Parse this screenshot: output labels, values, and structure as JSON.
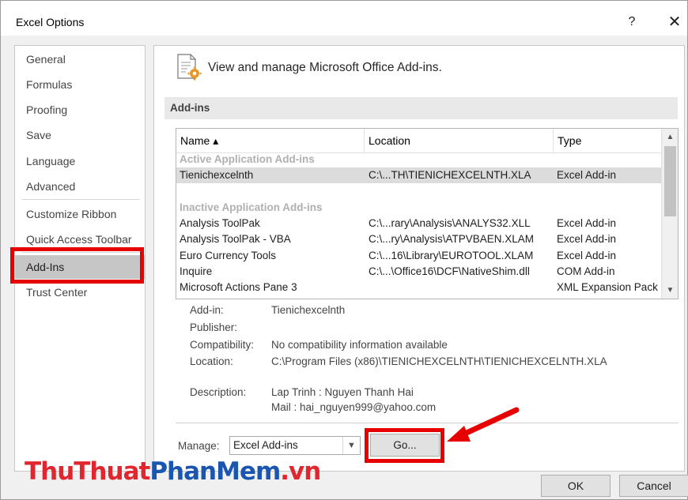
{
  "window": {
    "title": "Excel Options",
    "help_label": "?",
    "close_label": "✕"
  },
  "sidebar": {
    "items": [
      {
        "label": "General"
      },
      {
        "label": "Formulas"
      },
      {
        "label": "Proofing"
      },
      {
        "label": "Save"
      },
      {
        "label": "Language"
      },
      {
        "label": "Advanced"
      },
      {
        "label": "Customize Ribbon"
      },
      {
        "label": "Quick Access Toolbar"
      },
      {
        "label": "Add-Ins"
      },
      {
        "label": "Trust Center"
      }
    ],
    "selected": "Add-Ins"
  },
  "main": {
    "header": "View and manage Microsoft Office Add-ins.",
    "section_title": "Add-ins",
    "table": {
      "columns": [
        "Name ▴",
        "Location",
        "Type"
      ],
      "groups": [
        {
          "title": "Active Application Add-ins",
          "rows": [
            [
              "Tienichexcelnth",
              "C:\\...TH\\TIENICHEXCELNTH.XLA",
              "Excel Add-in"
            ]
          ]
        },
        {
          "title": "Inactive Application Add-ins",
          "rows": [
            [
              "Analysis ToolPak",
              "C:\\...rary\\Analysis\\ANALYS32.XLL",
              "Excel Add-in"
            ],
            [
              "Analysis ToolPak - VBA",
              "C:\\...ry\\Analysis\\ATPVBAEN.XLAM",
              "Excel Add-in"
            ],
            [
              "Euro Currency Tools",
              "C:\\...16\\Library\\EUROTOOL.XLAM",
              "Excel Add-in"
            ],
            [
              "Inquire",
              "C:\\...\\Office16\\DCF\\NativeShim.dll",
              "COM Add-in"
            ],
            [
              "Microsoft Actions Pane 3",
              "",
              "XML Expansion Pack"
            ]
          ]
        }
      ]
    },
    "details": {
      "addin_label": "Add-in:",
      "addin_value": "Tienichexcelnth",
      "publisher_label": "Publisher:",
      "publisher_value": "",
      "compat_label": "Compatibility:",
      "compat_value": "No compatibility information available",
      "location_label": "Location:",
      "location_value": "C:\\Program Files (x86)\\TIENICHEXCELNTH\\TIENICHEXCELNTH.XLA",
      "desc_label": "Description:",
      "desc_line1": "Lap Trinh : Nguyen Thanh Hai",
      "desc_line2": "Mail : hai_nguyen999@yahoo.com"
    },
    "manage": {
      "label": "Manage:",
      "selected": "Excel Add-ins",
      "go_label": "Go..."
    }
  },
  "footer": {
    "ok_label": "OK",
    "cancel_label": "Cancel"
  },
  "watermark": {
    "part1": "ThuThuat",
    "part2": "PhanMem",
    "part3": ".vn"
  },
  "colors": {
    "highlight": "#e60000",
    "watermark_red": "#e0262e",
    "watermark_blue": "#1a56b0",
    "selected_bg": "#c6c6c6"
  }
}
